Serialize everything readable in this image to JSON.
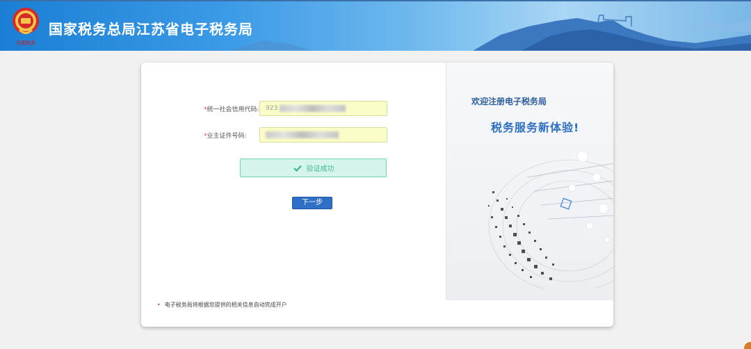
{
  "header": {
    "title": "国家税务总局江苏省电子税务局",
    "logo_caption": "中国税务"
  },
  "form": {
    "credit_code_label": "统一社会信用代码:",
    "credit_code_value": "923",
    "id_number_label": "业主证件号码:",
    "required_mark": "*",
    "verify_status": "验证成功",
    "next_button": "下一步",
    "note": "电子税务局将根据您提供的相关信息自动完成开户",
    "note_bullet": "•"
  },
  "promo": {
    "welcome": "欢迎注册电子税务局",
    "slogan": "税务服务新体验!"
  },
  "colors": {
    "header_blue": "#1a7fd4",
    "input_bg": "#fbfdc8",
    "success_bg": "#d5f4ec",
    "success_text": "#42b893",
    "button_blue": "#2f6fc6",
    "title_blue": "#2d5e9e"
  },
  "icons": {
    "logo": "tax-emblem-icon",
    "check": "check-icon"
  }
}
